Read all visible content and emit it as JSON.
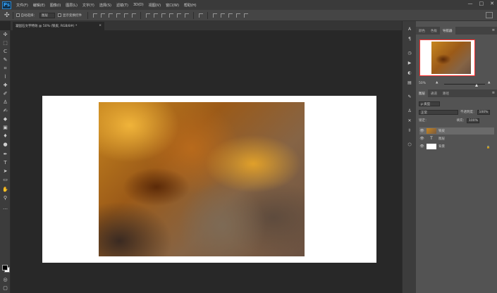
{
  "menubar": {
    "logo": "Ps",
    "items": [
      "文件(F)",
      "编辑(E)",
      "图像(I)",
      "图层(L)",
      "文字(Y)",
      "选择(S)",
      "滤镜(T)",
      "3D(D)",
      "视图(V)",
      "窗口(W)",
      "帮助(H)"
    ],
    "window_controls": [
      "—",
      "□",
      "✕"
    ]
  },
  "options": {
    "auto_select_label": "自动选择：",
    "auto_select_value": "图层",
    "transform_label": "显示变换控件"
  },
  "document": {
    "tab_title": "凝固石文字特效 @ 50% (铁皮, RGB/8#) *",
    "tab_close": "×"
  },
  "panels": {
    "top_tabs": [
      "颜色",
      "色板",
      "导航器"
    ],
    "zoom_value": "50%",
    "layer_tabs": [
      "图层",
      "通道",
      "路径"
    ],
    "kind_filter": "ρ 类型",
    "blend_mode": "正常",
    "opacity_label": "不透明度：",
    "opacity_value": "100%",
    "lock_label": "锁定：",
    "fill_label": "填充：",
    "fill_value": "100%",
    "layers": [
      {
        "name": "铁皮",
        "type": "image",
        "selected": true
      },
      {
        "name": "图层",
        "type": "text",
        "selected": false
      },
      {
        "name": "背景",
        "type": "background",
        "selected": false
      }
    ],
    "panel_menu_icon": "≡"
  },
  "icons": {
    "move": "✣",
    "text_layer": "T",
    "eye": "👁",
    "lock": "🔒"
  },
  "colors": {
    "foreground": "#000000",
    "background": "#ffffff",
    "nav_frame": "#ff2a2a"
  }
}
